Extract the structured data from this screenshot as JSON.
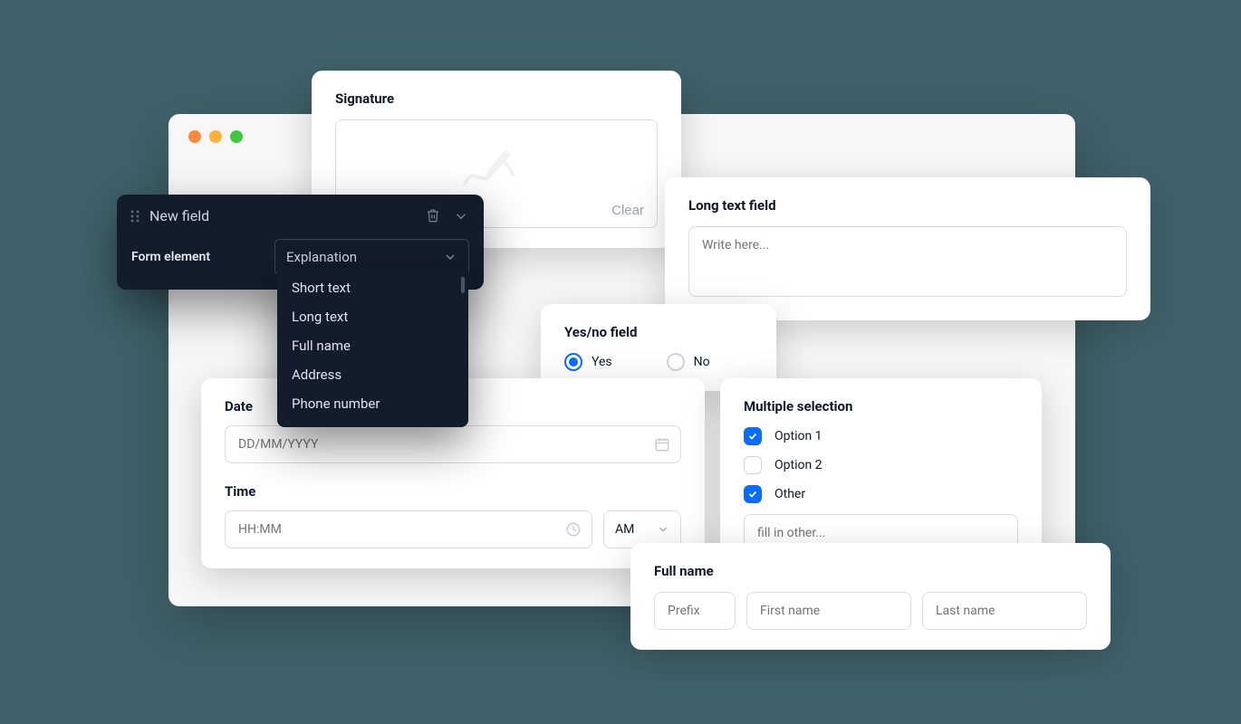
{
  "signature": {
    "title": "Signature",
    "clear": "Clear"
  },
  "newField": {
    "title": "New field",
    "formElementLabel": "Form element",
    "selected": "Explanation",
    "options": [
      "Short text",
      "Long text",
      "Full name",
      "Address",
      "Phone number"
    ]
  },
  "longText": {
    "title": "Long text field",
    "placeholder": "Write here..."
  },
  "yesno": {
    "title": "Yes/no field",
    "yes": "Yes",
    "no": "No"
  },
  "date": {
    "label": "Date",
    "placeholder": "DD/MM/YYYY"
  },
  "time": {
    "label": "Time",
    "placeholder": "HH:MM",
    "ampm": "AM"
  },
  "multi": {
    "title": "Multiple selection",
    "option1": "Option 1",
    "option2": "Option 2",
    "other": "Other",
    "otherPlaceholder": "fill in other..."
  },
  "fullname": {
    "title": "Full name",
    "prefix": "Prefix",
    "first": "First name",
    "last": "Last name"
  }
}
